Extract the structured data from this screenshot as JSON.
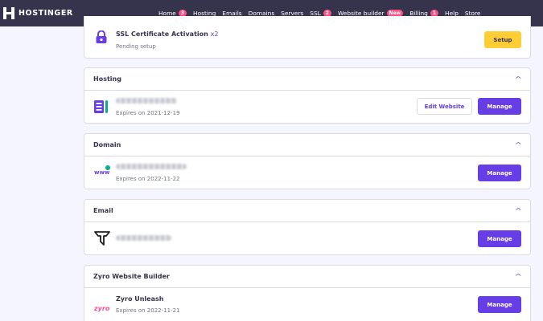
{
  "brand": {
    "name": "HOSTINGER"
  },
  "nav": [
    {
      "label": "Home",
      "badge": "3"
    },
    {
      "label": "Hosting"
    },
    {
      "label": "Emails"
    },
    {
      "label": "Domains"
    },
    {
      "label": "Servers"
    },
    {
      "label": "SSL",
      "badge": "2"
    },
    {
      "label": "Website builder",
      "badge": "New"
    },
    {
      "label": "Billing",
      "badge": "1"
    },
    {
      "label": "Help"
    },
    {
      "label": "Store"
    }
  ],
  "ssl_card": {
    "name": "SSL Certificate Activation",
    "multiplier": "x2",
    "status": "Pending setup",
    "button": "Setup"
  },
  "hosting_card": {
    "title": "Hosting",
    "expires": "Expires on 2021-12-19",
    "edit_button": "Edit Website",
    "manage_button": "Manage"
  },
  "domain_card": {
    "title": "Domain",
    "icon_text": "www",
    "expires": "Expires on 2022-11-22",
    "manage_button": "Manage"
  },
  "email_card": {
    "title": "Email",
    "manage_button": "Manage"
  },
  "zyro_card": {
    "title": "Zyro Website Builder",
    "logo_text": "zyro",
    "name": "Zyro Unleash",
    "expires": "Expires on 2022-11-21",
    "manage_button": "Manage"
  },
  "colors": {
    "topbar": "#36344d",
    "primary": "#673de6",
    "badge": "#fc5185",
    "setup": "#ffcd35",
    "background": "#f4f5ff"
  },
  "icons": {
    "hosting": "server-icon",
    "domain": "www-globe-icon",
    "email": "email-brand-icon",
    "ssl": "lock-icon",
    "collapse": "chevron-up-icon"
  }
}
